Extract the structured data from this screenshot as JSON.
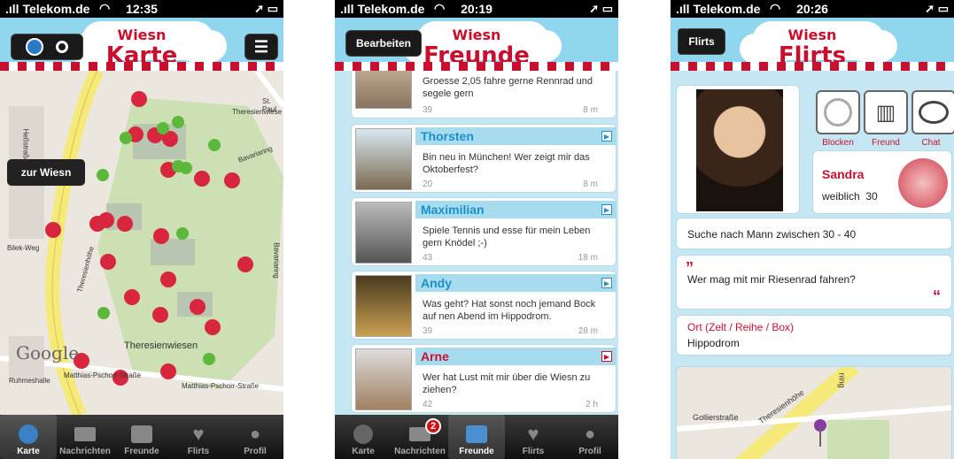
{
  "status": [
    {
      "carrier": "Telekom.de",
      "time": "12:35"
    },
    {
      "carrier": "Telekom.de",
      "time": "20:19"
    },
    {
      "carrier": "Telekom.de",
      "time": "20:26"
    }
  ],
  "screen1": {
    "logo_top": "Wiesn",
    "logo_main": "Karte",
    "zur_wiesn": "zur Wiesn",
    "map_labels": [
      "Theresienhöhe",
      "Theresienwiese",
      "Theresienwiesen",
      "St. Paul",
      "Bavariaring",
      "Bavariaring",
      "Ruhmeshalle",
      "Matthias-Pschorr-Straße",
      "Matthias-Pschorr-Straße",
      "Bilek-Weg",
      "Theresienhöhe",
      "Heßstraße"
    ],
    "google": "Google"
  },
  "screen2": {
    "edit_label": "Bearbeiten",
    "logo_top": "Wiesn",
    "logo_main": "Freunde",
    "friends": [
      {
        "name": "",
        "message": "Groesse 2,05 fahre gerne Rennrad und segele gern",
        "age": "39",
        "distance": "8 m"
      },
      {
        "name": "Thorsten",
        "message": "Bin neu in München! Wer zeigt mir das Oktoberfest?",
        "age": "20",
        "distance": "8 m"
      },
      {
        "name": "Maximilian",
        "message": "Spiele Tennis und esse für mein Leben gern Knödel ;-)",
        "age": "43",
        "distance": "18 m"
      },
      {
        "name": "Andy",
        "message": "Was geht? Hat sonst noch jemand Bock auf nen Abend im Hippodrom.",
        "age": "39",
        "distance": "28 m"
      },
      {
        "name": "Arne",
        "message": "Wer hat Lust mit mir über die Wiesn zu ziehen?",
        "age": "42",
        "distance": "2 h"
      }
    ],
    "badge": "2"
  },
  "screen3": {
    "back_label": "Flirts",
    "logo_top": "Wiesn",
    "logo_main": "Flirts",
    "actions": [
      "Blocken",
      "Freund",
      "Chat"
    ],
    "name": "Sandra",
    "gender": "weiblich",
    "age": "30",
    "search": "Suche nach Mann zwischen 30 - 40",
    "quote_open": "”",
    "quote": "Wer mag mit mir Riesenrad fahren?",
    "quote_close": "“",
    "location_label": "Ort (Zelt / Reihe / Box)",
    "location": "Hippodrom",
    "map_labels": [
      "Gollierstraße",
      "Theresienhöhe",
      "ning"
    ]
  },
  "tabs": [
    "Karte",
    "Nachrichten",
    "Freunde",
    "Flirts",
    "Profil"
  ],
  "colors": {
    "accent_red": "#c8102e",
    "sky": "#8fd6ee",
    "name_blue": "#1a8fc9",
    "name_red": "#c8102e"
  }
}
